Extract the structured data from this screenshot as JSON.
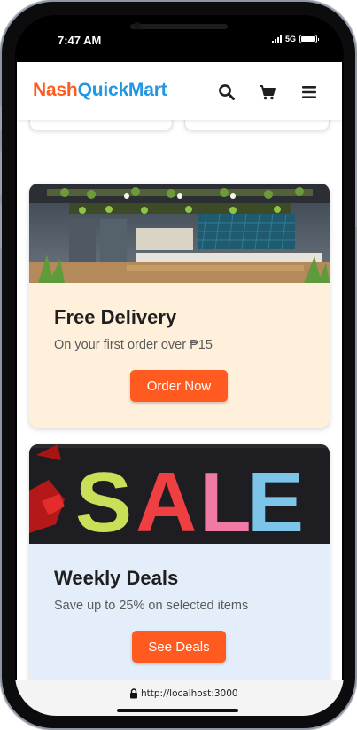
{
  "status_bar": {
    "time": "7:47 AM",
    "network": "5G"
  },
  "header": {
    "logo_part1": "Nash",
    "logo_part2": "QuickMart",
    "icons": [
      "search-icon",
      "cart-icon",
      "menu-icon"
    ]
  },
  "promos": [
    {
      "title": "Free Delivery",
      "subtitle": "On your first order over ₱15",
      "button": "Order Now",
      "background": "#fff0dc"
    },
    {
      "title": "Weekly Deals",
      "subtitle": "Save up to 25% on selected items",
      "button": "See Deals",
      "background": "#e3eefa",
      "image_text": "SALE"
    }
  ],
  "browser": {
    "url": "http://localhost:3000"
  },
  "colors": {
    "brand_orange": "#ff5a1f",
    "brand_blue": "#2196e3"
  }
}
